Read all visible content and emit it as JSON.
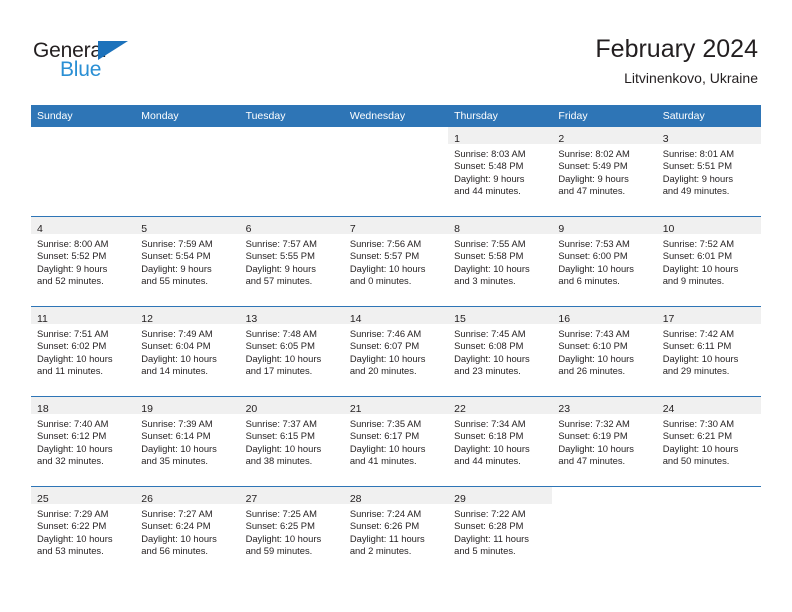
{
  "brand": {
    "name_top": "General",
    "name_bottom": "Blue",
    "logo_colors": {
      "text_dark": "#231f20",
      "text_blue": "#2a8fd4",
      "triangle": "#1c72bb"
    }
  },
  "header": {
    "title": "February 2024",
    "subtitle": "Litvinenkovo, Ukraine"
  },
  "theme": {
    "header_blue": "#2e75b6",
    "daynum_band": "#f0f0f0",
    "text": "#231f20"
  },
  "weekday_headers": [
    "Sunday",
    "Monday",
    "Tuesday",
    "Wednesday",
    "Thursday",
    "Friday",
    "Saturday"
  ],
  "labels": {
    "sunrise_prefix": "Sunrise:",
    "sunset_prefix": "Sunset:",
    "daylight_prefix": "Daylight:"
  },
  "weeks": [
    [
      {
        "empty": true
      },
      {
        "empty": true
      },
      {
        "empty": true
      },
      {
        "empty": true
      },
      {
        "day": "1",
        "sunrise": "Sunrise: 8:03 AM",
        "sunset": "Sunset: 5:48 PM",
        "daylight_line1": "Daylight: 9 hours",
        "daylight_line2": "and 44 minutes."
      },
      {
        "day": "2",
        "sunrise": "Sunrise: 8:02 AM",
        "sunset": "Sunset: 5:49 PM",
        "daylight_line1": "Daylight: 9 hours",
        "daylight_line2": "and 47 minutes."
      },
      {
        "day": "3",
        "sunrise": "Sunrise: 8:01 AM",
        "sunset": "Sunset: 5:51 PM",
        "daylight_line1": "Daylight: 9 hours",
        "daylight_line2": "and 49 minutes."
      }
    ],
    [
      {
        "day": "4",
        "sunrise": "Sunrise: 8:00 AM",
        "sunset": "Sunset: 5:52 PM",
        "daylight_line1": "Daylight: 9 hours",
        "daylight_line2": "and 52 minutes."
      },
      {
        "day": "5",
        "sunrise": "Sunrise: 7:59 AM",
        "sunset": "Sunset: 5:54 PM",
        "daylight_line1": "Daylight: 9 hours",
        "daylight_line2": "and 55 minutes."
      },
      {
        "day": "6",
        "sunrise": "Sunrise: 7:57 AM",
        "sunset": "Sunset: 5:55 PM",
        "daylight_line1": "Daylight: 9 hours",
        "daylight_line2": "and 57 minutes."
      },
      {
        "day": "7",
        "sunrise": "Sunrise: 7:56 AM",
        "sunset": "Sunset: 5:57 PM",
        "daylight_line1": "Daylight: 10 hours",
        "daylight_line2": "and 0 minutes."
      },
      {
        "day": "8",
        "sunrise": "Sunrise: 7:55 AM",
        "sunset": "Sunset: 5:58 PM",
        "daylight_line1": "Daylight: 10 hours",
        "daylight_line2": "and 3 minutes."
      },
      {
        "day": "9",
        "sunrise": "Sunrise: 7:53 AM",
        "sunset": "Sunset: 6:00 PM",
        "daylight_line1": "Daylight: 10 hours",
        "daylight_line2": "and 6 minutes."
      },
      {
        "day": "10",
        "sunrise": "Sunrise: 7:52 AM",
        "sunset": "Sunset: 6:01 PM",
        "daylight_line1": "Daylight: 10 hours",
        "daylight_line2": "and 9 minutes."
      }
    ],
    [
      {
        "day": "11",
        "sunrise": "Sunrise: 7:51 AM",
        "sunset": "Sunset: 6:02 PM",
        "daylight_line1": "Daylight: 10 hours",
        "daylight_line2": "and 11 minutes."
      },
      {
        "day": "12",
        "sunrise": "Sunrise: 7:49 AM",
        "sunset": "Sunset: 6:04 PM",
        "daylight_line1": "Daylight: 10 hours",
        "daylight_line2": "and 14 minutes."
      },
      {
        "day": "13",
        "sunrise": "Sunrise: 7:48 AM",
        "sunset": "Sunset: 6:05 PM",
        "daylight_line1": "Daylight: 10 hours",
        "daylight_line2": "and 17 minutes."
      },
      {
        "day": "14",
        "sunrise": "Sunrise: 7:46 AM",
        "sunset": "Sunset: 6:07 PM",
        "daylight_line1": "Daylight: 10 hours",
        "daylight_line2": "and 20 minutes."
      },
      {
        "day": "15",
        "sunrise": "Sunrise: 7:45 AM",
        "sunset": "Sunset: 6:08 PM",
        "daylight_line1": "Daylight: 10 hours",
        "daylight_line2": "and 23 minutes."
      },
      {
        "day": "16",
        "sunrise": "Sunrise: 7:43 AM",
        "sunset": "Sunset: 6:10 PM",
        "daylight_line1": "Daylight: 10 hours",
        "daylight_line2": "and 26 minutes."
      },
      {
        "day": "17",
        "sunrise": "Sunrise: 7:42 AM",
        "sunset": "Sunset: 6:11 PM",
        "daylight_line1": "Daylight: 10 hours",
        "daylight_line2": "and 29 minutes."
      }
    ],
    [
      {
        "day": "18",
        "sunrise": "Sunrise: 7:40 AM",
        "sunset": "Sunset: 6:12 PM",
        "daylight_line1": "Daylight: 10 hours",
        "daylight_line2": "and 32 minutes."
      },
      {
        "day": "19",
        "sunrise": "Sunrise: 7:39 AM",
        "sunset": "Sunset: 6:14 PM",
        "daylight_line1": "Daylight: 10 hours",
        "daylight_line2": "and 35 minutes."
      },
      {
        "day": "20",
        "sunrise": "Sunrise: 7:37 AM",
        "sunset": "Sunset: 6:15 PM",
        "daylight_line1": "Daylight: 10 hours",
        "daylight_line2": "and 38 minutes."
      },
      {
        "day": "21",
        "sunrise": "Sunrise: 7:35 AM",
        "sunset": "Sunset: 6:17 PM",
        "daylight_line1": "Daylight: 10 hours",
        "daylight_line2": "and 41 minutes."
      },
      {
        "day": "22",
        "sunrise": "Sunrise: 7:34 AM",
        "sunset": "Sunset: 6:18 PM",
        "daylight_line1": "Daylight: 10 hours",
        "daylight_line2": "and 44 minutes."
      },
      {
        "day": "23",
        "sunrise": "Sunrise: 7:32 AM",
        "sunset": "Sunset: 6:19 PM",
        "daylight_line1": "Daylight: 10 hours",
        "daylight_line2": "and 47 minutes."
      },
      {
        "day": "24",
        "sunrise": "Sunrise: 7:30 AM",
        "sunset": "Sunset: 6:21 PM",
        "daylight_line1": "Daylight: 10 hours",
        "daylight_line2": "and 50 minutes."
      }
    ],
    [
      {
        "day": "25",
        "sunrise": "Sunrise: 7:29 AM",
        "sunset": "Sunset: 6:22 PM",
        "daylight_line1": "Daylight: 10 hours",
        "daylight_line2": "and 53 minutes."
      },
      {
        "day": "26",
        "sunrise": "Sunrise: 7:27 AM",
        "sunset": "Sunset: 6:24 PM",
        "daylight_line1": "Daylight: 10 hours",
        "daylight_line2": "and 56 minutes."
      },
      {
        "day": "27",
        "sunrise": "Sunrise: 7:25 AM",
        "sunset": "Sunset: 6:25 PM",
        "daylight_line1": "Daylight: 10 hours",
        "daylight_line2": "and 59 minutes."
      },
      {
        "day": "28",
        "sunrise": "Sunrise: 7:24 AM",
        "sunset": "Sunset: 6:26 PM",
        "daylight_line1": "Daylight: 11 hours",
        "daylight_line2": "and 2 minutes."
      },
      {
        "day": "29",
        "sunrise": "Sunrise: 7:22 AM",
        "sunset": "Sunset: 6:28 PM",
        "daylight_line1": "Daylight: 11 hours",
        "daylight_line2": "and 5 minutes."
      },
      {
        "empty": true
      },
      {
        "empty": true
      }
    ]
  ]
}
